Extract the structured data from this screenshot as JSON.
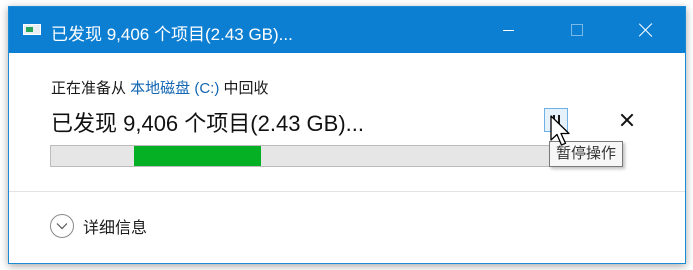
{
  "window": {
    "title": "已发现 9,406 个项目(2.43 GB)...",
    "accent_color": "#0d7fd3"
  },
  "status": {
    "prefix": "正在准备从 ",
    "location_link": "本地磁盘 (C:)",
    "suffix": " 中回收",
    "main_text": "已发现 9,406 个项目(2.43 GB)..."
  },
  "progress": {
    "state": "indeterminate",
    "fill_color": "#06b025"
  },
  "controls": {
    "pause_icon": "pause-icon",
    "cancel_icon": "close-icon",
    "pause_tooltip": "暂停操作"
  },
  "details": {
    "label": "详细信息",
    "icon": "chevron-down-icon"
  }
}
